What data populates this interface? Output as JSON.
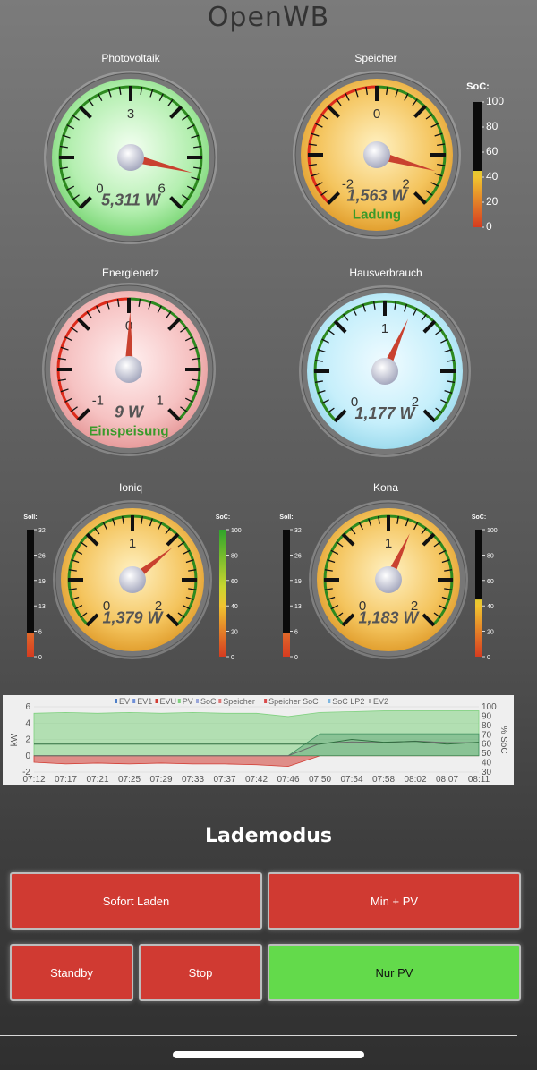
{
  "app_title": "OpenWB",
  "colors": {
    "button_red": "#d03a32",
    "button_green": "#63da4b",
    "arc_green": "#2d8a1f",
    "arc_red": "#dd2a1a"
  },
  "gauges": [
    {
      "name": "photovoltaik",
      "label": "Photovoltaik",
      "min": 0,
      "max": 6,
      "ticks": [
        "0",
        "3",
        "6"
      ],
      "value_text": "5,311 W",
      "sub_text": "",
      "value": 5.311,
      "face": "green",
      "arcs": [
        [
          0,
          6,
          "green"
        ]
      ],
      "needle": "red-long"
    },
    {
      "name": "speicher",
      "label": "Speicher",
      "min": -2,
      "max": 2,
      "ticks": [
        "-2",
        "0",
        "2"
      ],
      "value_text": "1,563 W",
      "sub_text": "Ladung",
      "value": 1.563,
      "face": "orange",
      "arcs": [
        [
          -2,
          0,
          "red"
        ],
        [
          0,
          2,
          "green"
        ]
      ],
      "needle": "red-long"
    },
    {
      "name": "energienetz",
      "label": "Energienetz",
      "min": -1,
      "max": 1,
      "ticks": [
        "-1",
        "0",
        "1"
      ],
      "value_text": "9 W",
      "sub_text": "Einspeisung",
      "value": 0.009,
      "face": "red",
      "arcs": [
        [
          -1,
          0,
          "red"
        ],
        [
          0,
          1,
          "green"
        ]
      ],
      "needle": "red"
    },
    {
      "name": "hausverbrauch",
      "label": "Hausverbrauch",
      "min": 0,
      "max": 2,
      "ticks": [
        "0",
        "1",
        "2"
      ],
      "value_text": "1,177 W",
      "sub_text": "",
      "value": 1.177,
      "face": "blue",
      "arcs": [
        [
          0,
          2,
          "green"
        ]
      ],
      "needle": "red"
    },
    {
      "name": "ioniq",
      "label": "Ioniq",
      "min": 0,
      "max": 2,
      "ticks": [
        "0",
        "1",
        "2"
      ],
      "value_text": "1,379 W",
      "sub_text": "",
      "value": 1.379,
      "face": "orange",
      "arcs": [
        [
          0,
          2,
          "green"
        ]
      ],
      "needle": "red"
    },
    {
      "name": "kona",
      "label": "Kona",
      "min": 0,
      "max": 2,
      "ticks": [
        "0",
        "1",
        "2"
      ],
      "value_text": "1,183 W",
      "sub_text": "",
      "value": 1.183,
      "face": "orange",
      "arcs": [
        [
          0,
          2,
          "green"
        ]
      ],
      "needle": "red"
    }
  ],
  "bars": {
    "speicher_soc": {
      "label": "SoC:",
      "ticks": [
        "100",
        "80",
        "60",
        "40",
        "20",
        "0"
      ],
      "value_fraction": 0.45,
      "scheme": "soc"
    },
    "ioniq_soll": {
      "label": "Soll:",
      "ticks": [
        "32",
        "26",
        "19",
        "13",
        "6",
        "0"
      ],
      "value_fraction": 0.19,
      "scheme": "soll"
    },
    "ioniq_soc": {
      "label": "SoC:",
      "ticks": [
        "100",
        "80",
        "60",
        "40",
        "20",
        "0"
      ],
      "value_fraction": 1.0,
      "scheme": "soc"
    },
    "kona_soll": {
      "label": "Soll:",
      "ticks": [
        "32",
        "26",
        "19",
        "13",
        "6",
        "0"
      ],
      "value_fraction": 0.19,
      "scheme": "soll"
    },
    "kona_soc": {
      "label": "SoC:",
      "ticks": [
        "100",
        "80",
        "60",
        "40",
        "20",
        "0"
      ],
      "value_fraction": 0.45,
      "scheme": "soc"
    }
  },
  "chart_data": {
    "type": "area",
    "xlabel": "",
    "ylabel": "kW",
    "y2label": "% SoC",
    "ylim": [
      -2,
      6
    ],
    "y2lim": [
      30,
      100
    ],
    "yticks": [
      "6",
      "4",
      "2",
      "0",
      "-2"
    ],
    "y2ticks": [
      "100",
      "90",
      "80",
      "70",
      "60",
      "50",
      "40",
      "30"
    ],
    "categories": [
      "07:12",
      "07:17",
      "07:21",
      "07:25",
      "07:29",
      "07:33",
      "07:37",
      "07:42",
      "07:46",
      "07:50",
      "07:54",
      "07:58",
      "08:02",
      "08:07",
      "08:11"
    ],
    "legend": [
      "EV",
      "EV1",
      "EVU",
      "PV",
      "SoC",
      "Speicher",
      "Speicher SoC",
      "SoC LP2",
      "EV2"
    ],
    "legend_colors": [
      "#4e7fc8",
      "#6f8fd8",
      "#d23c33",
      "#7fd17f",
      "#9aa6d9",
      "#d77",
      "#d94b4b",
      "#7fb7e0",
      "#aaa"
    ],
    "series": [
      {
        "name": "PV",
        "values": [
          5.2,
          5.3,
          5.2,
          5.3,
          5.2,
          5.3,
          5.2,
          5.2,
          4.8,
          5.3,
          5.4,
          5.5,
          5.5,
          5.5,
          5.5
        ]
      },
      {
        "name": "EVU",
        "values": [
          -0.8,
          -1.0,
          -0.9,
          -1.0,
          -0.9,
          -1.0,
          -1.0,
          -1.1,
          -1.3,
          0.0,
          0.0,
          0.0,
          0.0,
          0.0,
          0.0
        ]
      },
      {
        "name": "EV",
        "values": [
          0,
          0,
          0,
          0,
          0,
          0,
          0,
          0,
          0,
          2.7,
          2.7,
          2.7,
          2.7,
          2.7,
          2.7
        ]
      },
      {
        "name": "SoC",
        "values": [
          60,
          60,
          60,
          60,
          60,
          60,
          60,
          60,
          60,
          60,
          65,
          62,
          63,
          60,
          62
        ]
      },
      {
        "name": "Speicher",
        "values": [
          0,
          0,
          0,
          0,
          0,
          0,
          0,
          0,
          0,
          1.5,
          1.7,
          1.6,
          1.8,
          1.6,
          1.6
        ]
      }
    ]
  },
  "ladeModus": {
    "title": "Lademodus",
    "buttons": [
      {
        "name": "sofort-laden-button",
        "label": "Sofort Laden",
        "active": false
      },
      {
        "name": "min-pv-button",
        "label": "Min + PV",
        "active": false
      },
      {
        "name": "standby-button",
        "label": "Standby",
        "active": false
      },
      {
        "name": "stop-button",
        "label": "Stop",
        "active": false
      },
      {
        "name": "nur-pv-button",
        "label": "Nur PV",
        "active": true
      }
    ]
  }
}
